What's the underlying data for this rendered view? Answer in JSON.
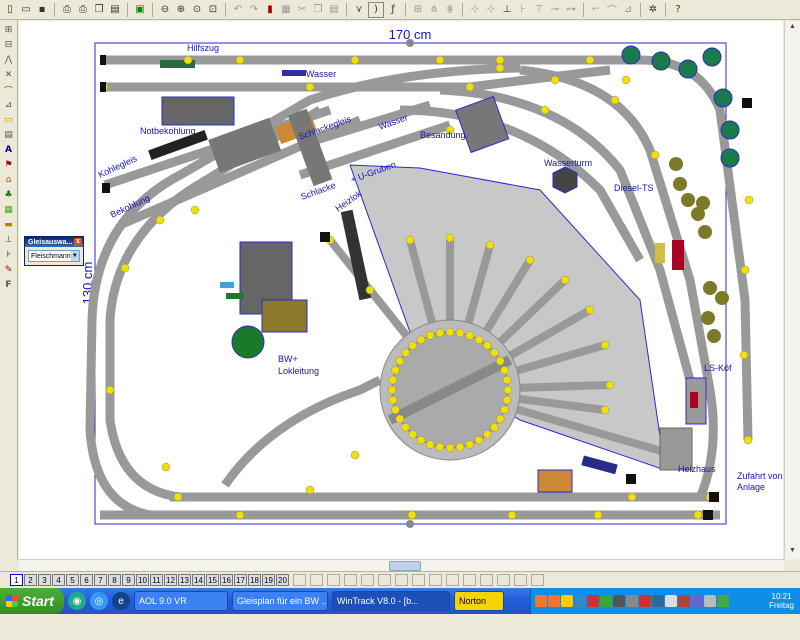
{
  "toolbar": {
    "icons": [
      "new-file-icon",
      "open-folder-icon",
      "save-icon",
      "print-preview-icon",
      "print-icon",
      "copy-icon",
      "paste-icon",
      "image-icon",
      "zoom-out-icon",
      "zoom-in-icon",
      "zoom-fit-icon",
      "zoom-window-icon",
      "undo-icon",
      "redo-icon",
      "delete-icon",
      "group-icon",
      "cut-icon",
      "copy2-icon",
      "paste2-icon",
      "track-straight-icon",
      "track-curve-icon",
      "flex-icon",
      "rotate-icon",
      "mirror-icon",
      "align-icon",
      "measure-icon",
      "grid-icon",
      "snap-icon",
      "settings-icon",
      "help-icon"
    ]
  },
  "layout": {
    "width_label": "170 cm",
    "height_label": "130 cm",
    "labels": {
      "hilfszug": "Hilfszug",
      "wasser1": "Wasser",
      "notbekohlung": "Notbekohlung",
      "schlackegleis": "Schlackegleis",
      "wasser2": "Wasser",
      "besandung": "Besandung",
      "kohlegleis": "Kohlegleis",
      "bekohlung": "Bekohlung",
      "schlacke": "Schlacke",
      "ugruben": "+ U-Gruben",
      "wasserturm": "Wasserturm",
      "diesel_ts": "Diesel-TS",
      "heizlok": "Heizlok",
      "bw_lokleitung_1": "BW+",
      "bw_lokleitung_2": "Lokleitung",
      "ls_koef": "LS-Köf",
      "heizhaus": "Heizhaus",
      "zufahrt_1": "Zufahrt von",
      "zufahrt_2": "Anlage"
    }
  },
  "gleisauswahl": {
    "title": "Gleisauswa...",
    "selected": "Fleischmann",
    "close": "x"
  },
  "layerbar": {
    "layers": [
      "1",
      "2",
      "3",
      "4",
      "5",
      "6",
      "7",
      "8",
      "9",
      "10",
      "11",
      "12",
      "13",
      "14",
      "15",
      "16",
      "17",
      "18",
      "19",
      "20"
    ],
    "active": "1"
  },
  "taskbar": {
    "start": "Start",
    "tasks": [
      {
        "label": "AOL 9.0 VR",
        "icon": "aol-icon"
      },
      {
        "label": "Gleisplan für ein BW ...",
        "icon": "firefox-icon"
      },
      {
        "label": "WinTrack V8.0 - [b...",
        "icon": "wintrack-icon",
        "active": true
      },
      {
        "label": "Norton",
        "icon": "norton-icon"
      }
    ],
    "clock_time": "10:21",
    "clock_day": "Freitag"
  }
}
